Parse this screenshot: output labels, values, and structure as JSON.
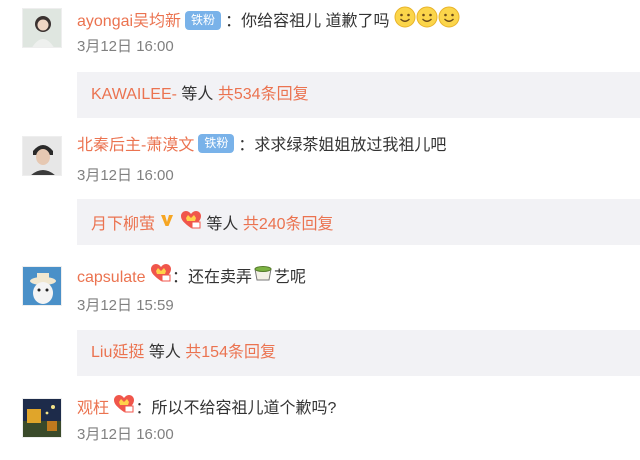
{
  "comments": [
    {
      "user": "ayongai吴均新",
      "badge": "铁粉",
      "text": "你给容祖儿 道歉了吗",
      "time": "3月12日 16:00",
      "reply": {
        "user": "KAWAILEE-",
        "etc": "等人",
        "count": "共534条回复"
      }
    },
    {
      "user": "北秦后主-萧漠文",
      "badge": "铁粉",
      "text": "求求绿茶姐姐放过我祖儿吧",
      "time": "3月12日 16:00",
      "reply": {
        "user": "月下柳萤",
        "etc": "等人",
        "count": "共240条回复"
      }
    },
    {
      "user": "capsulate",
      "text_before": "还在卖弄",
      "text_after": "艺呢",
      "time": "3月12日 15:59",
      "reply": {
        "user": "Liu延挺",
        "etc": "等人",
        "count": "共154条回复"
      }
    },
    {
      "user": "观枉",
      "text": "所以不给容祖儿道个歉吗?",
      "time": "3月12日 16:00"
    }
  ],
  "colon": "：",
  "colors": {
    "name": "#eb7350",
    "time": "#808080",
    "reply_bg": "#f2f2f5",
    "fan_badge": "#79b2e9"
  },
  "icons": [
    "smile-emoji-icon",
    "vip-heart-badge-icon",
    "gold-v-icon",
    "green-tea-emoji-icon"
  ]
}
